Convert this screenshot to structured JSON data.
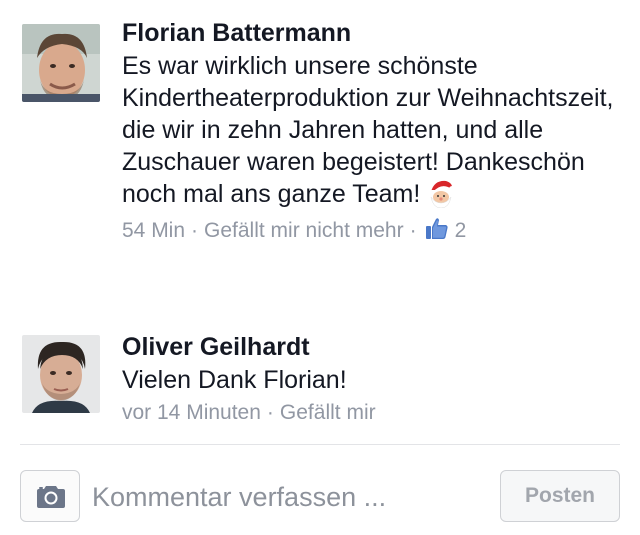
{
  "colors": {
    "text": "#141823",
    "meta": "#9197a3",
    "like_blue": "#4a78c8",
    "divider": "#e3e4e7"
  },
  "comments": [
    {
      "author": "Florian Battermann",
      "text": "Es war wirklich unsere schönste Kindertheaterproduktion zur Weihnachtszeit, die wir in zehn Jahren hatten, und alle Zuschauer waren begeistert! Dankeschön noch mal ans ganze Team!",
      "emoji": "santa-claus-emoji",
      "time": "54 Min",
      "like_action": "Gefällt mir nicht mehr",
      "like_icon": "thumbs-up-icon",
      "like_count": "2"
    },
    {
      "author": "Oliver Geilhardt",
      "text": "Vielen Dank Florian!",
      "time": "vor 14 Minuten",
      "like_action": "Gefällt mir"
    }
  ],
  "composer": {
    "camera_icon": "camera-icon",
    "placeholder": "Kommentar verfassen ...",
    "value": "",
    "post_label": "Posten"
  }
}
